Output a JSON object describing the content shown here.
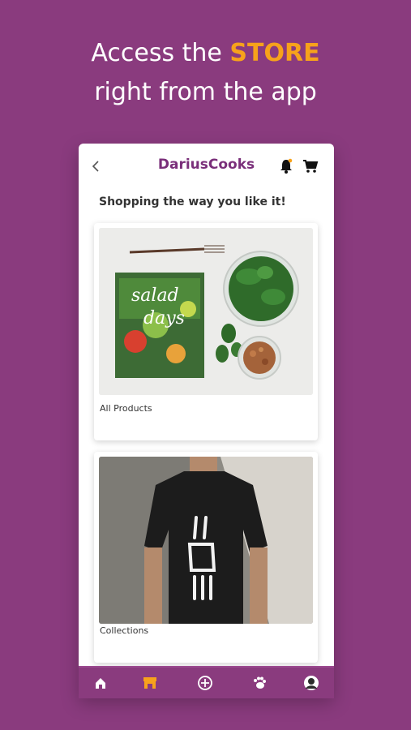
{
  "promo": {
    "line1_prefix": "Access the ",
    "line1_accent": "STORE",
    "line2": "right from the app"
  },
  "app": {
    "title": "DariusCooks",
    "subtitle": "Shopping the way you like it!",
    "cards": [
      {
        "label": "All Products",
        "image": "salad-days-book-spinach-image"
      },
      {
        "label": "Collections",
        "image": "skeleton-hand-tshirt-image"
      }
    ],
    "icons": {
      "back": "back-icon",
      "bell": "bell-icon",
      "cart": "cart-icon"
    }
  },
  "bottom_nav": {
    "items": [
      "home-icon",
      "store-icon",
      "add-icon",
      "paw-icon",
      "avatar"
    ],
    "active": "store-icon"
  },
  "colors": {
    "background": "#8a3b7e",
    "accent": "#f7a21b",
    "brand": "#7a2f7a",
    "active_nav": "#f7a21b"
  }
}
